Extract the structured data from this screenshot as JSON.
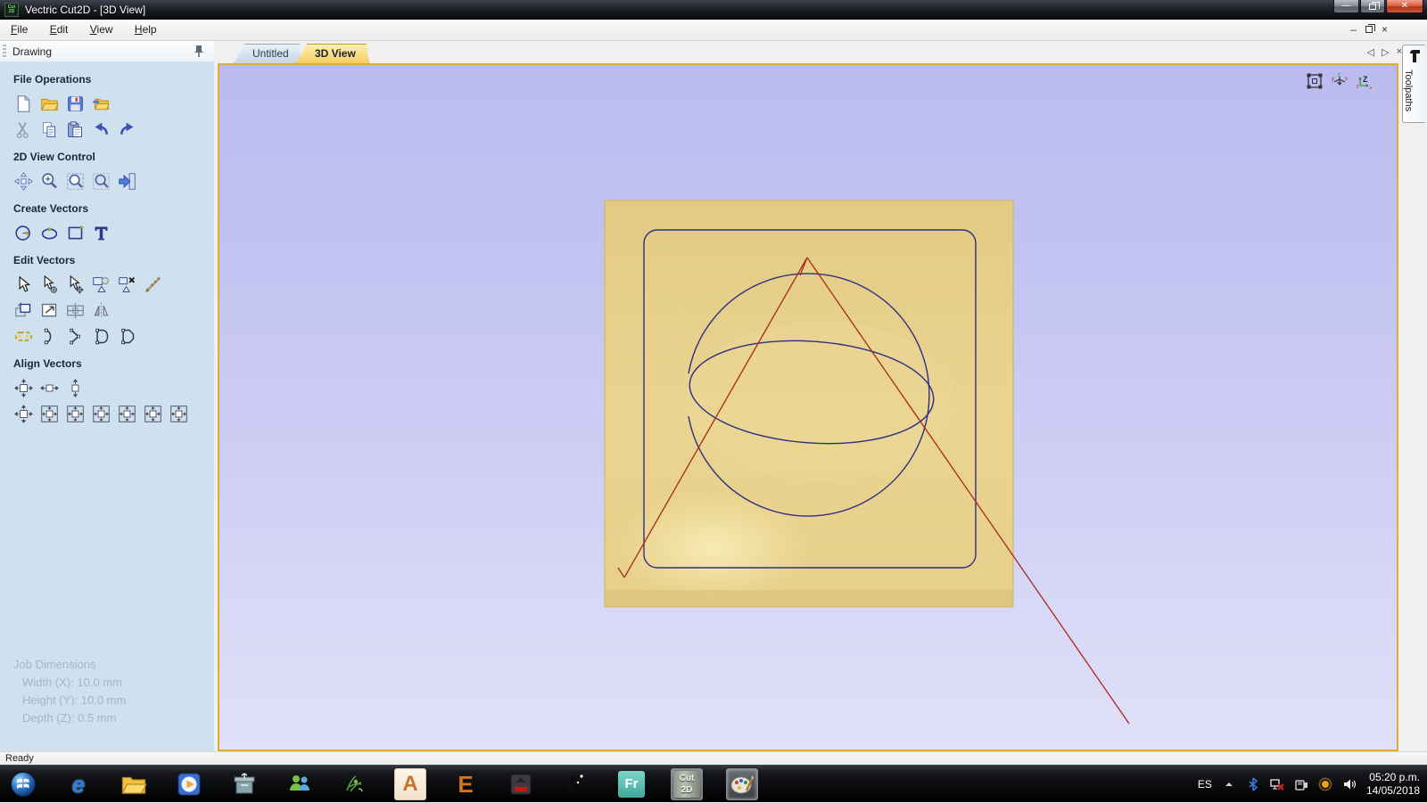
{
  "window": {
    "title": "Vectric Cut2D - [3D View]"
  },
  "menu": {
    "items": [
      "File",
      "Edit",
      "View",
      "Help"
    ]
  },
  "mdi": {
    "minimize_glyph": "–",
    "close_glyph": "×"
  },
  "panel": {
    "title": "Drawing",
    "sections": {
      "file_operations": {
        "title": "File Operations",
        "icons": [
          "new-file-icon",
          "open-file-icon",
          "save-file-icon",
          "import-vectors-icon",
          "cut-icon",
          "copy-icon",
          "paste-icon",
          "undo-icon",
          "redo-icon"
        ]
      },
      "view_control": {
        "title": "2D View Control",
        "icons": [
          "pan-view-icon",
          "zoom-interactive-icon",
          "zoom-box-icon",
          "zoom-drawing-icon",
          "switch-pane-icon"
        ]
      },
      "create_vectors": {
        "title": "Create Vectors",
        "icons": [
          "draw-circle-icon",
          "draw-ellipse-icon",
          "draw-rectangle-icon",
          "draw-text-icon"
        ]
      },
      "edit_vectors": {
        "title": "Edit Vectors",
        "icons": [
          "select-tool-icon",
          "node-edit-icon",
          "transform-tool-icon",
          "group-vectors-icon",
          "ungroup-vectors-icon",
          "measure-icon",
          "offset-vectors-icon",
          "set-size-icon",
          "stretch-icon",
          "mirror-icon",
          "weld-vectors-icon",
          "join-curve-icon",
          "fit-curve-icon",
          "fillet-icon",
          "chamfer-icon"
        ]
      },
      "align_vectors": {
        "title": "Align Vectors",
        "icons": [
          "align-centre-icon",
          "align-h-centre-icon",
          "align-v-centre-icon",
          "centre-in-material-icon",
          "align-left-icon",
          "align-right-icon",
          "align-top-icon",
          "align-bottom-icon",
          "align-h-material-icon",
          "align-v-material-icon"
        ]
      }
    },
    "job_dimensions": {
      "title": "Job Dimensions",
      "width": "Width (X): 10.0 mm",
      "height": "Height (Y): 10.0 mm",
      "depth": "Depth (Z): 0.5 mm"
    }
  },
  "tabs": {
    "untitled": "Untitled",
    "view3d": "3D View",
    "prev_glyph": "◁",
    "next_glyph": "▷",
    "close_glyph": "×"
  },
  "canvas": {
    "view_icons": [
      "zoom-extents-3d-icon",
      "isometric-view-icon",
      "plan-view-z-icon"
    ],
    "scene": "3d-preview of 10mm square material block with rounded-rectangle vector, sphere vectors and red toolpath lines"
  },
  "toolpaths": {
    "label": "Toolpaths"
  },
  "statusbar": {
    "text": "Ready"
  },
  "taskbar": {
    "apps": [
      "start",
      "internet-explorer",
      "windows-explorer",
      "media-player",
      "winrar-app",
      "messenger",
      "design-app",
      "autocad",
      "editor-e-app",
      "media-red-app",
      "pipe-tool-app",
      "fr-app",
      "vectric-cut2d",
      "paint-app"
    ],
    "glyphs": {
      "ie": "e",
      "autocad": "A",
      "e_app": "E",
      "fr": "Fr",
      "cut2d_top": "Cut",
      "cut2d_bottom": "2D"
    },
    "tray": {
      "language": "ES",
      "time": "05:20 p.m.",
      "date": "14/05/2018"
    }
  },
  "colors": {
    "accent_gold": "#ddad3c",
    "canvas_top": "#bbbbf0",
    "canvas_bottom": "#e0e0f9",
    "material_tan": "#e8d18c",
    "vector_navy": "#2e2e85",
    "toolpath_red": "#a8281e",
    "panel_blue": "#cfe0ee",
    "close_red": "#b03316"
  }
}
